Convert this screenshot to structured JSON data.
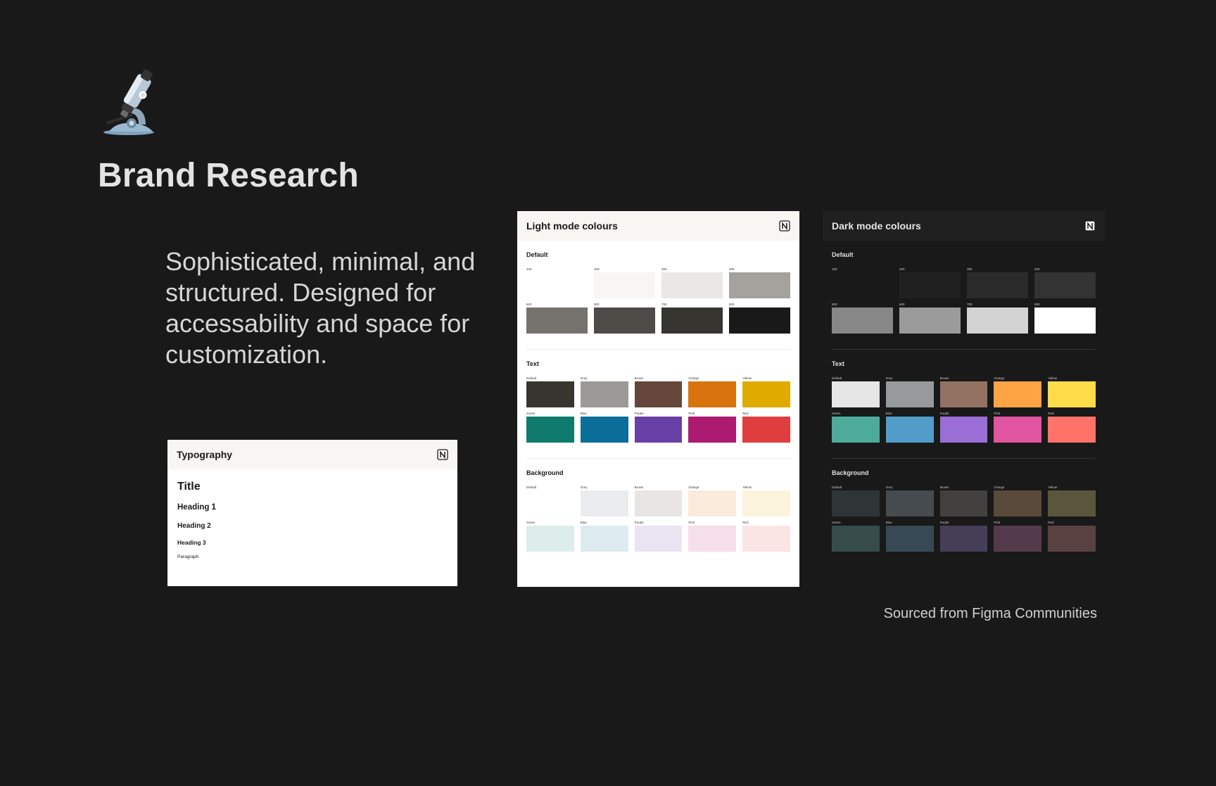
{
  "page": {
    "title": "Brand Research",
    "tagline": "Sophisticated, minimal, and structured. Designed for accessability and space for customization.",
    "credit": "Sourced from Figma Communities",
    "icon": "microscope-icon"
  },
  "typography": {
    "title": "Typography",
    "icon": "notion-logo-icon",
    "samples": {
      "title": "Title",
      "heading1": "Heading 1",
      "heading2": "Heading 2",
      "heading3": "Heading 3",
      "paragraph": "Paragraph"
    }
  },
  "light_mode": {
    "title": "Light mode colours",
    "icon": "notion-logo-icon",
    "sections": [
      {
        "label": "Default",
        "columns": 4,
        "swatches": [
          {
            "label": "100",
            "color": "#ffffff"
          },
          {
            "label": "200",
            "color": "#f7f6f3"
          },
          {
            "label": "300",
            "color": "#e9e8e4"
          },
          {
            "label": "400",
            "color": "#a3a29c"
          },
          {
            "label": "500",
            "color": "#73726d"
          },
          {
            "label": "600",
            "color": "#4c4b47"
          },
          {
            "label": "700",
            "color": "#37352f"
          },
          {
            "label": "800",
            "color": "#191919"
          }
        ]
      },
      {
        "label": "Text",
        "columns": 5,
        "swatches": [
          {
            "label": "Default",
            "color": "#37352f"
          },
          {
            "label": "Grey",
            "color": "#9b9a97"
          },
          {
            "label": "Brown",
            "color": "#64473a"
          },
          {
            "label": "Orange",
            "color": "#d9730d"
          },
          {
            "label": "Yellow",
            "color": "#dfab01"
          },
          {
            "label": "Green",
            "color": "#0f7b6c"
          },
          {
            "label": "Blue",
            "color": "#0b6e99"
          },
          {
            "label": "Purple",
            "color": "#6940a5"
          },
          {
            "label": "Pink",
            "color": "#ad1a72"
          },
          {
            "label": "Red",
            "color": "#e03e3e"
          }
        ]
      },
      {
        "label": "Background",
        "columns": 5,
        "swatches": [
          {
            "label": "Default",
            "color": "#ffffff"
          },
          {
            "label": "Grey",
            "color": "#ebeced"
          },
          {
            "label": "Brown",
            "color": "#e9e5e3"
          },
          {
            "label": "Orange",
            "color": "#faebdd"
          },
          {
            "label": "Yellow",
            "color": "#fbf3db"
          },
          {
            "label": "Green",
            "color": "#ddedea"
          },
          {
            "label": "Blue",
            "color": "#ddebf1"
          },
          {
            "label": "Purple",
            "color": "#eae4f2"
          },
          {
            "label": "Pink",
            "color": "#f4dfeb"
          },
          {
            "label": "Red",
            "color": "#fbe4e4"
          }
        ]
      }
    ]
  },
  "dark_mode": {
    "title": "Dark mode colours",
    "icon": "notion-logo-icon",
    "sections": [
      {
        "label": "Default",
        "columns": 4,
        "swatches": [
          {
            "label": "100",
            "color": "#191919"
          },
          {
            "label": "200",
            "color": "#202020"
          },
          {
            "label": "300",
            "color": "#2a2a2a"
          },
          {
            "label": "400",
            "color": "#333333"
          },
          {
            "label": "500",
            "color": "#878787"
          },
          {
            "label": "600",
            "color": "#9b9b9b"
          },
          {
            "label": "700",
            "color": "#d3d3d3"
          },
          {
            "label": "800",
            "color": "#ffffff"
          }
        ]
      },
      {
        "label": "Text",
        "columns": 5,
        "swatches": [
          {
            "label": "Default",
            "color": "#e6e6e6"
          },
          {
            "label": "Grey",
            "color": "#979a9b"
          },
          {
            "label": "Brown",
            "color": "#937264"
          },
          {
            "label": "Orange",
            "color": "#ffa344"
          },
          {
            "label": "Yellow",
            "color": "#ffdc49"
          },
          {
            "label": "Green",
            "color": "#4dab9a"
          },
          {
            "label": "Blue",
            "color": "#529cca"
          },
          {
            "label": "Purple",
            "color": "#9a6dd7"
          },
          {
            "label": "Pink",
            "color": "#e255a1"
          },
          {
            "label": "Red",
            "color": "#ff7369"
          }
        ]
      },
      {
        "label": "Background",
        "columns": 5,
        "swatches": [
          {
            "label": "Default",
            "color": "#2f3437"
          },
          {
            "label": "Grey",
            "color": "#454b4e"
          },
          {
            "label": "Brown",
            "color": "#434040"
          },
          {
            "label": "Orange",
            "color": "#594a3a"
          },
          {
            "label": "Yellow",
            "color": "#59563b"
          },
          {
            "label": "Green",
            "color": "#354c4b"
          },
          {
            "label": "Blue",
            "color": "#364954"
          },
          {
            "label": "Purple",
            "color": "#443f57"
          },
          {
            "label": "Pink",
            "color": "#533b4c"
          },
          {
            "label": "Red",
            "color": "#594141"
          }
        ]
      }
    ]
  }
}
